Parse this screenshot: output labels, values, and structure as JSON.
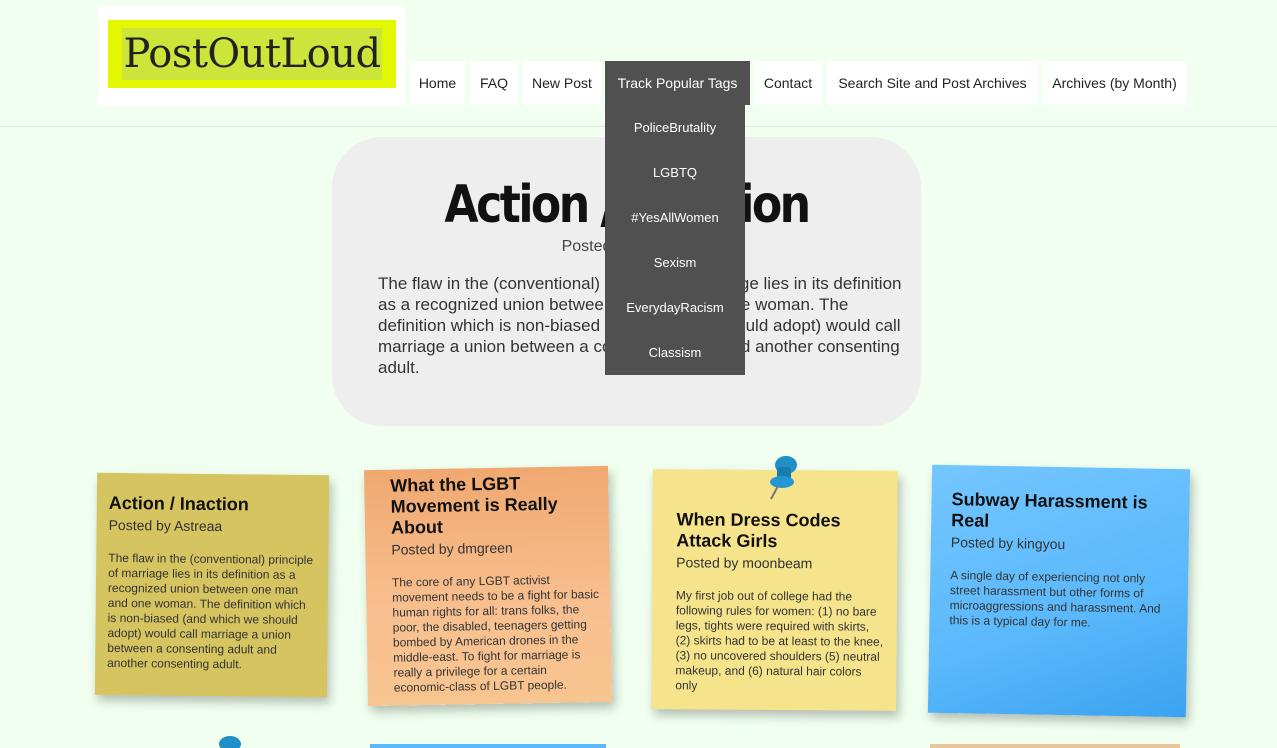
{
  "logo": {
    "text": "PostOutLoud"
  },
  "nav": {
    "items": [
      {
        "label": "Home"
      },
      {
        "label": "FAQ"
      },
      {
        "label": "New Post"
      },
      {
        "label": "Track Popular Tags"
      },
      {
        "label": "Contact"
      },
      {
        "label": "Search Site and Post Archives"
      },
      {
        "label": "Archives (by Month)"
      }
    ],
    "active": "Track Popular Tags",
    "dropdown": [
      "PoliceBrutality",
      "LGBTQ",
      "#YesAllWomen",
      "Sexism",
      "EverydayRacism",
      "Classism"
    ]
  },
  "hero": {
    "title": "Action / Inaction",
    "byline": "Posted by Astreaa",
    "body": "The flaw in the (conventional) principle of marriage lies in its definition as a recognized union between one man and one woman. The definition which is non-biased (and which we should adopt) would call marriage a union between a consenting adult and another consenting adult."
  },
  "notes": [
    {
      "title": "Action / Inaction",
      "byline": "Posted by Astreaa",
      "excerpt": "The flaw in the (conventional) principle of marriage lies in its definition as a recognized union between one man and one woman. The definition which is non-biased (and which we should adopt) would call marriage a union between a consenting adult and another consenting adult."
    },
    {
      "title": "What the LGBT Movement is Really About",
      "byline": "Posted by dmgreen",
      "excerpt": "The core of any LGBT activist movement needs to be a fight for basic human rights for all: trans folks, the poor, the disabled, teenagers getting bombed by American drones in the middle-east. To fight for marriage is really a privilege for a certain economic-class of LGBT people."
    },
    {
      "title": "When Dress Codes Attack Girls",
      "byline": "Posted by moonbeam",
      "excerpt": "My first job out of college had the following rules for women: (1) no bare legs, tights were required with skirts, (2) skirts had to be at least to the knee, (3) no uncovered shoulders (5) neutral makeup, and (6) natural hair colors only"
    },
    {
      "title": "Subway Harassment is Real",
      "byline": "Posted by kingyou",
      "excerpt": "A single day of experiencing not only street harassment but other forms of microaggressions and harassment. And this is a typical day for me."
    }
  ],
  "colors": {
    "background": "#f0fff0",
    "nav_active": "#505050",
    "logo_yellow": "#e3f700",
    "pin_blue": "#1f8fc8"
  }
}
